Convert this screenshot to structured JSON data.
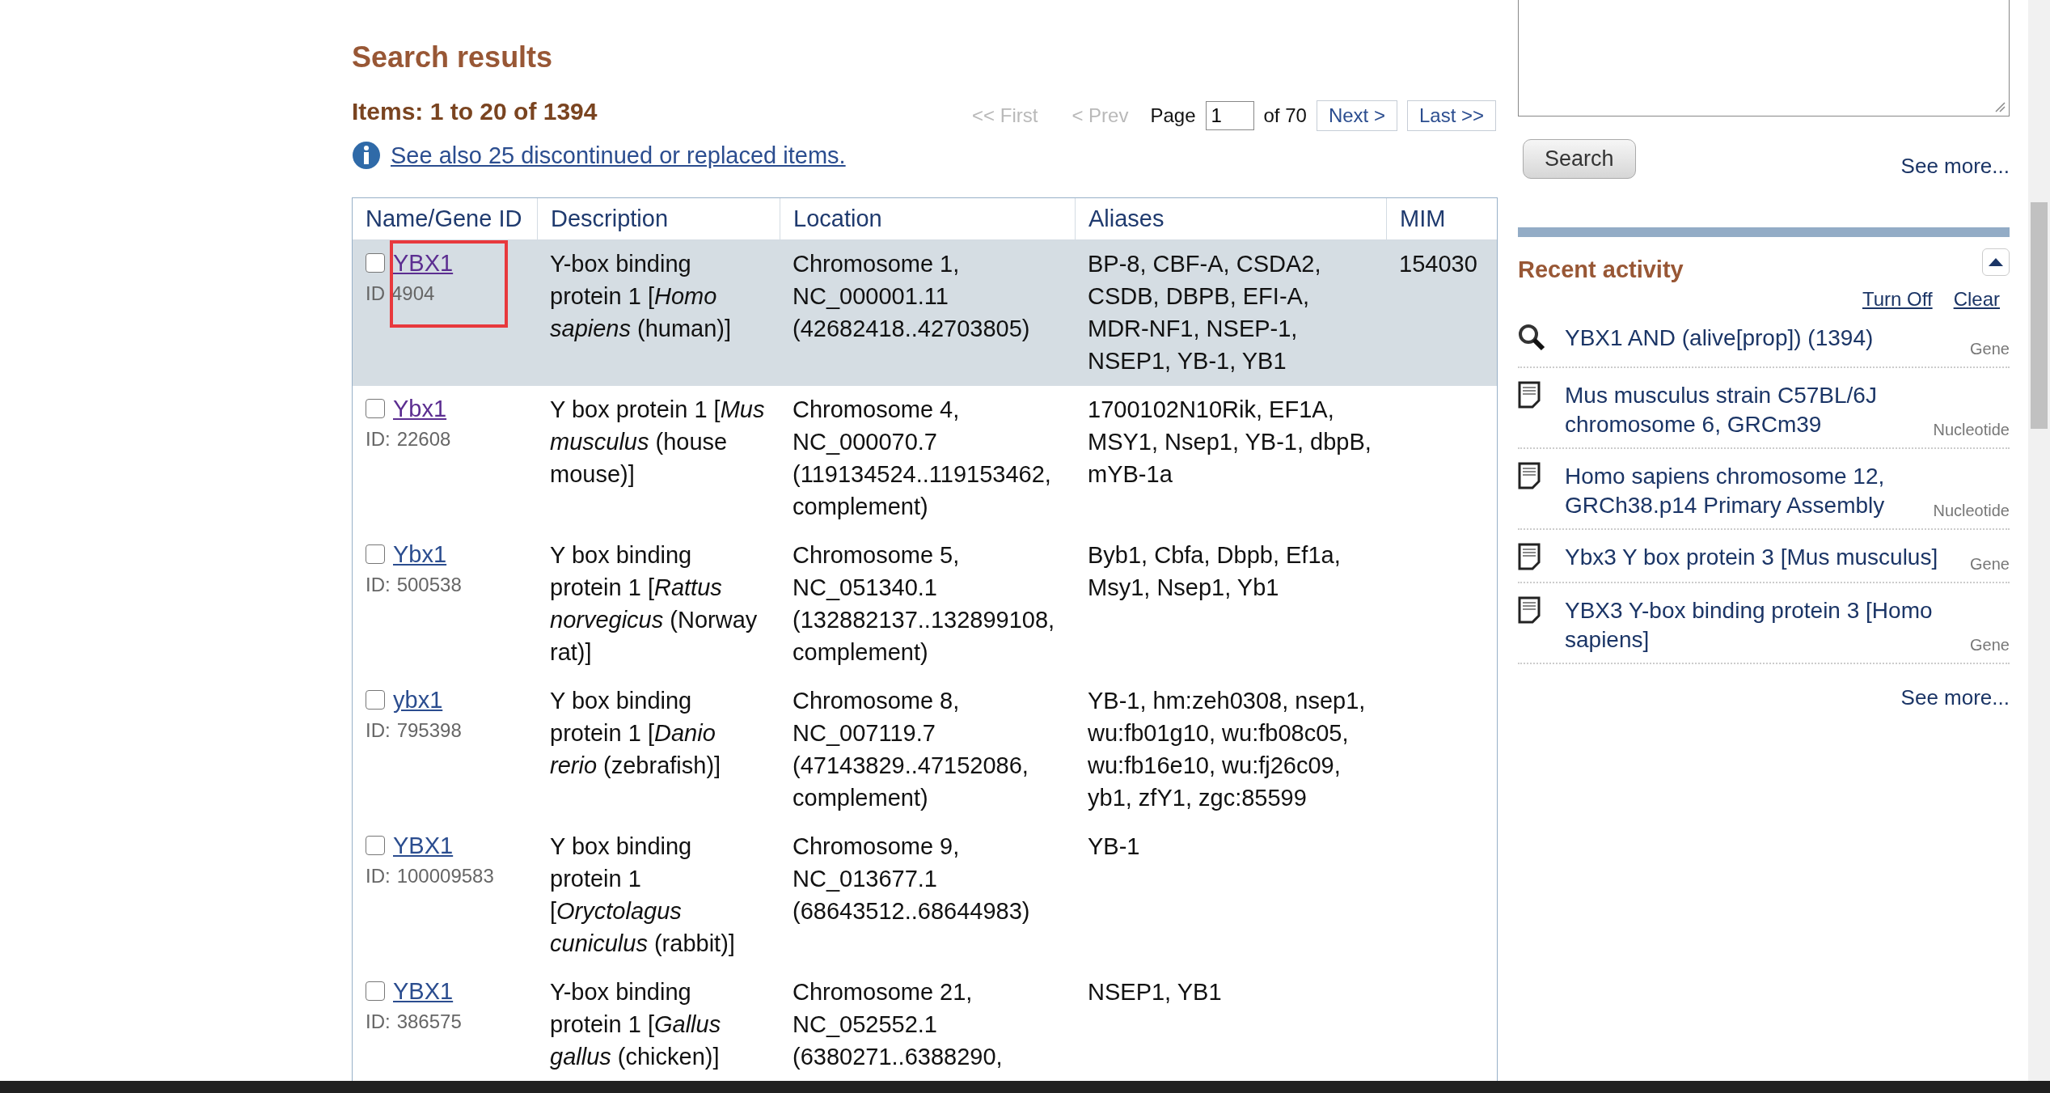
{
  "results": {
    "heading": "Search results",
    "items_count": "Items: 1 to 20 of 1394",
    "pager": {
      "first": {
        "label": "<< First",
        "disabled": true
      },
      "prev": {
        "label": "< Prev",
        "disabled": true
      },
      "page_label": "Page",
      "page_value": "1",
      "of_label": "of 70",
      "next": {
        "label": "Next >",
        "disabled": false
      },
      "last": {
        "label": "Last >>",
        "disabled": false
      }
    },
    "notice": "See also 25 discontinued or replaced items.",
    "table": {
      "columns": [
        "Name/Gene ID",
        "Description",
        "Location",
        "Aliases",
        "MIM"
      ],
      "rows": [
        {
          "selected": true,
          "highlighted": true,
          "checked": false,
          "visited": true,
          "name": "YBX1",
          "id_label": "ID",
          "id": "4904",
          "description": "Y-box binding protein 1 [*Homo sapiens* (human)]",
          "location": "Chromosome 1, NC_000001.11 (42682418..42703805)",
          "aliases": "BP-8, CBF-A, CSDA2, CSDB, DBPB, EFI-A, MDR-NF1, NSEP-1, NSEP1, YB-1, YB1",
          "mim": "154030"
        },
        {
          "selected": false,
          "highlighted": false,
          "checked": false,
          "visited": true,
          "name": "Ybx1",
          "id_label": "ID:",
          "id": "22608",
          "description": "Y box protein 1 [*Mus musculus* (house mouse)]",
          "location": "Chromosome 4, NC_000070.7 (119134524..119153462, complement)",
          "aliases": "1700102N10Rik, EF1A, MSY1, Nsep1, YB-1, dbpB, mYB-1a"
        },
        {
          "selected": false,
          "highlighted": false,
          "checked": false,
          "visited": false,
          "name": "Ybx1",
          "id_label": "ID:",
          "id": "500538",
          "description": "Y box binding protein 1 [*Rattus norvegicus* (Norway rat)]",
          "location": "Chromosome 5, NC_051340.1 (132882137..132899108, complement)",
          "aliases": "Byb1, Cbfa, Dbpb, Ef1a, Msy1, Nsep1, Yb1"
        },
        {
          "selected": false,
          "highlighted": false,
          "checked": false,
          "visited": false,
          "name": "ybx1",
          "id_label": "ID:",
          "id": "795398",
          "description": "Y box binding protein 1 [*Danio rerio* (zebrafish)]",
          "location": "Chromosome 8, NC_007119.7 (47143829..47152086, complement)",
          "aliases": "YB-1, hm:zeh0308, nsep1, wu:fb01g10, wu:fb08c05, wu:fb16e10, wu:fj26c09, yb1, zfY1, zgc:85599"
        },
        {
          "selected": false,
          "highlighted": false,
          "checked": false,
          "visited": false,
          "name": "YBX1",
          "id_label": "ID:",
          "id": "100009583",
          "description": "Y box binding protein 1 [*Oryctolagus cuniculus* (rabbit)]",
          "location": "Chromosome 9, NC_013677.1 (68643512..68644983)",
          "aliases": "YB-1"
        },
        {
          "selected": false,
          "highlighted": false,
          "checked": false,
          "visited": false,
          "name": "YBX1",
          "id_label": "ID:",
          "id": "386575",
          "description": "Y-box binding protein 1 [*Gallus gallus* (chicken)]",
          "location": "Chromosome 21, NC_052552.1 (6380271..6388290,",
          "aliases": "NSEP1, YB1"
        }
      ]
    }
  },
  "sidebar": {
    "search_button": "Search",
    "see_more_top": "See more...",
    "recent": {
      "heading": "Recent activity",
      "expanded": true,
      "turn_off": "Turn Off",
      "clear": "Clear",
      "items": [
        {
          "kind": "search",
          "title": "YBX1 AND (alive[prop]) (1394)",
          "database": "Gene"
        },
        {
          "kind": "document",
          "title": "Mus musculus strain C57BL/6J chromosome 6, GRCm39",
          "database": "Nucleotide"
        },
        {
          "kind": "document",
          "title": "Homo sapiens chromosome 12, GRCh38.p14 Primary Assembly",
          "database": "Nucleotide"
        },
        {
          "kind": "document",
          "title": "Ybx3 Y box protein 3 [Mus musculus]",
          "database": "Gene"
        },
        {
          "kind": "document",
          "title": "YBX3 Y-box binding protein 3 [Homo sapiens]",
          "database": "Gene"
        }
      ],
      "see_more": "See more..."
    }
  }
}
